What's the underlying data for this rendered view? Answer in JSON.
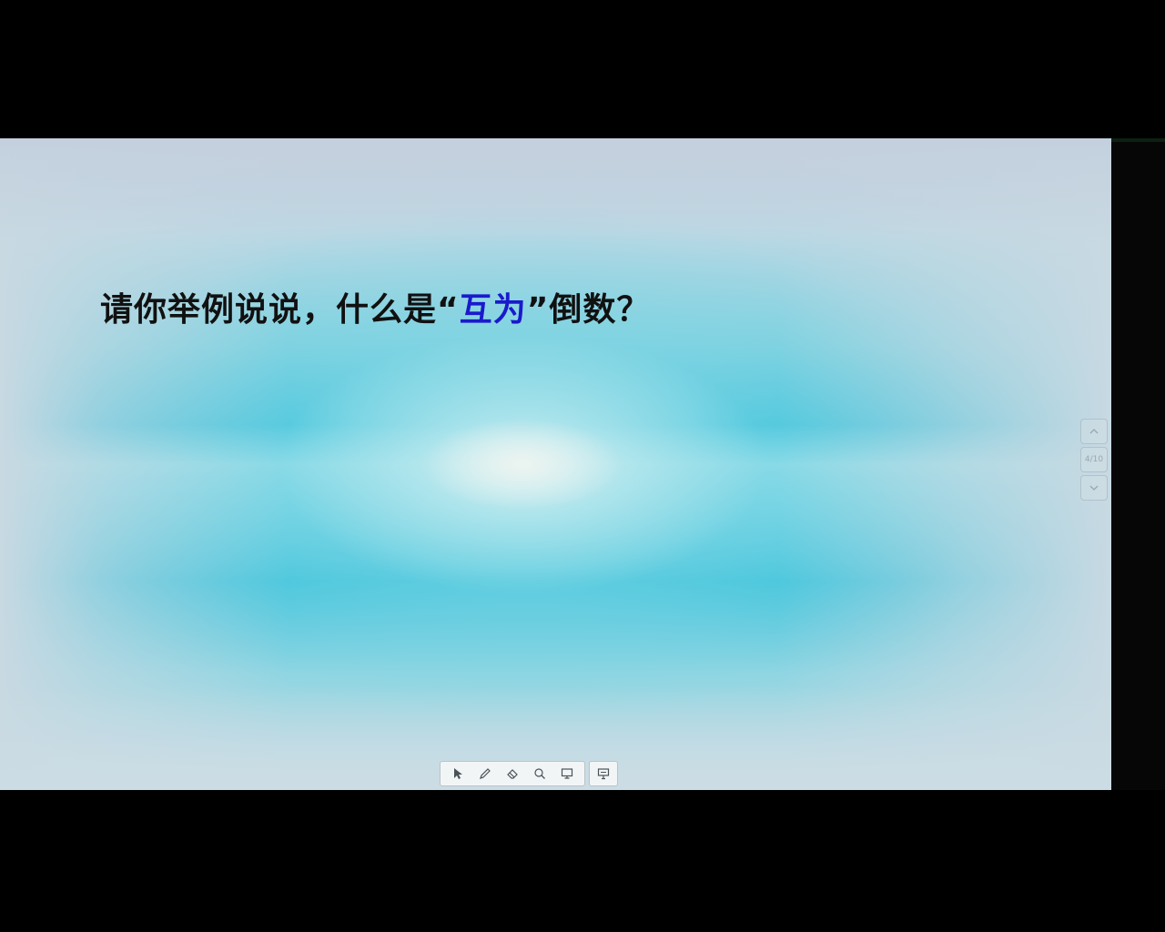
{
  "slide": {
    "question_part1": "请你举例说说，什么是“",
    "question_highlight": "互为",
    "question_part2": "”倒数？",
    "highlight_color": "#1a1acc",
    "text_color": "#111111"
  },
  "page_nav": {
    "prev_icon": "chevron-up-icon",
    "page_indicator": "4/10",
    "next_icon": "chevron-down-icon"
  },
  "toolbar": {
    "tools": [
      {
        "name": "pointer",
        "icon": "cursor-arrow-icon"
      },
      {
        "name": "pen",
        "icon": "pen-icon"
      },
      {
        "name": "eraser",
        "icon": "eraser-icon"
      },
      {
        "name": "search",
        "icon": "search-icon"
      },
      {
        "name": "screen",
        "icon": "monitor-icon"
      }
    ],
    "extra_tool": {
      "name": "whiteboard",
      "icon": "presentation-board-icon"
    }
  }
}
